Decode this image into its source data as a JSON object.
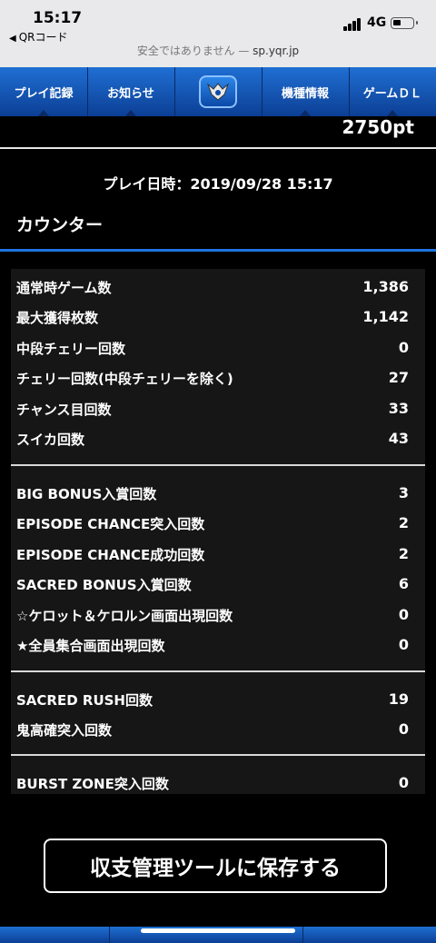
{
  "status": {
    "time": "15:17",
    "back_label": "QRコード",
    "network": "4G",
    "url_prefix": "安全ではありません — ",
    "url_host": "sp.yqr.jp"
  },
  "nav": {
    "items": [
      "プレイ記録",
      "お知らせ",
      "",
      "機種情報",
      "ゲームＤＬ"
    ]
  },
  "points": "2750pt",
  "play_datetime": "プレイ日時：2019/09/28 15:17",
  "section_title": "カウンター",
  "counters": [
    {
      "label": "通常時ゲーム数",
      "value": "1,386"
    },
    {
      "label": "最大獲得枚数",
      "value": "1,142"
    },
    {
      "label": "中段チェリー回数",
      "value": "0"
    },
    {
      "label": "チェリー回数(中段チェリーを除く)",
      "value": "27"
    },
    {
      "label": "チャンス目回数",
      "value": "33"
    },
    {
      "label": "スイカ回数",
      "value": "43"
    },
    {
      "label": "BIG BONUS入賞回数",
      "value": "3"
    },
    {
      "label": "EPISODE CHANCE突入回数",
      "value": "2"
    },
    {
      "label": "EPISODE CHANCE成功回数",
      "value": "2"
    },
    {
      "label": "SACRED BONUS入賞回数",
      "value": "6"
    },
    {
      "label": "☆ケロット＆ケロルン画面出現回数",
      "value": "0"
    },
    {
      "label": "★全員集合画面出現回数",
      "value": "0"
    },
    {
      "label": "SACRED RUSH回数",
      "value": "19"
    },
    {
      "label": "鬼高確突入回数",
      "value": "0"
    },
    {
      "label": "BURST ZONE突入回数",
      "value": "0"
    }
  ],
  "save_button": "収支管理ツールに保存する"
}
